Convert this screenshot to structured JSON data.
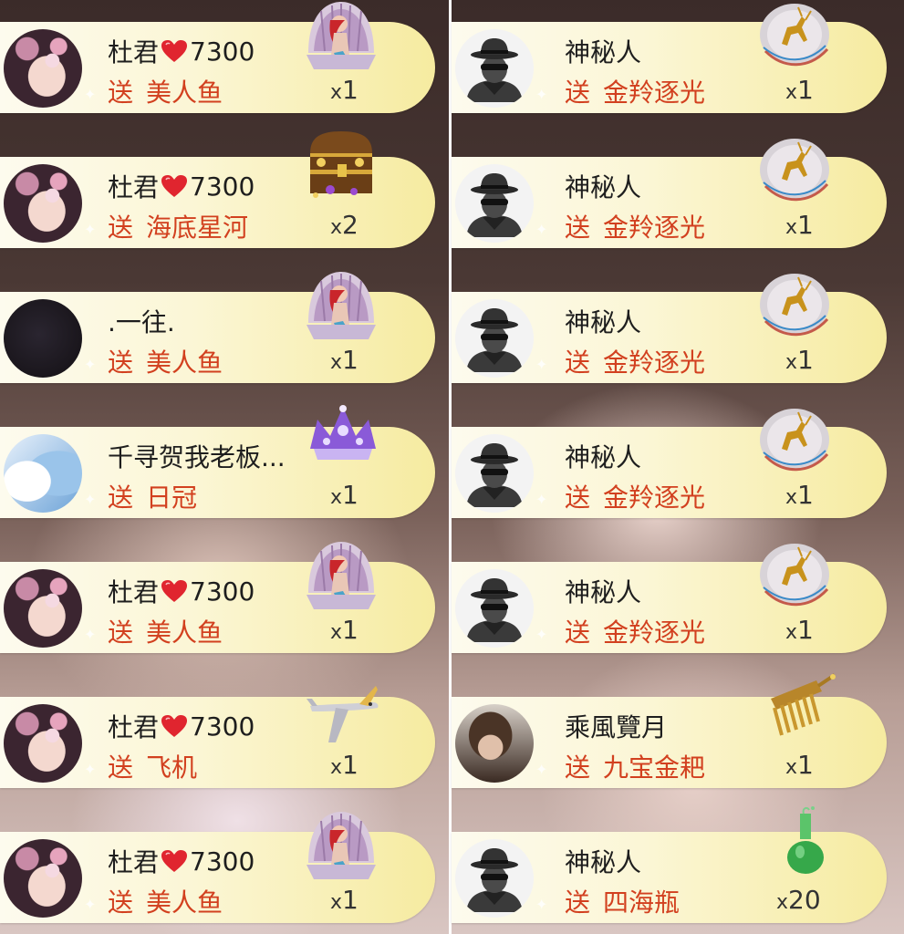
{
  "left_column": [
    {
      "name": "杜君",
      "level": "7300",
      "action": "送",
      "gift": "美人鱼",
      "count": "1",
      "avatar": "girl",
      "gift_icon": "mermaid-shell"
    },
    {
      "name": "杜君",
      "level": "7300",
      "action": "送",
      "gift": "海底星河",
      "count": "2",
      "avatar": "girl",
      "gift_icon": "treasure-chest"
    },
    {
      "name": ".一往.",
      "level": "",
      "action": "送",
      "gift": "美人鱼",
      "count": "1",
      "avatar": "dark",
      "gift_icon": "mermaid-shell"
    },
    {
      "name": "千寻贺我老板...",
      "level": "",
      "action": "送",
      "gift": "日冠",
      "count": "1",
      "avatar": "anime",
      "gift_icon": "purple-crown"
    },
    {
      "name": "杜君",
      "level": "7300",
      "action": "送",
      "gift": "美人鱼",
      "count": "1",
      "avatar": "girl",
      "gift_icon": "mermaid-shell"
    },
    {
      "name": "杜君",
      "level": "7300",
      "action": "送",
      "gift": "飞机",
      "count": "1",
      "avatar": "girl",
      "gift_icon": "airplane"
    },
    {
      "name": "杜君",
      "level": "7300",
      "action": "送",
      "gift": "美人鱼",
      "count": "1",
      "avatar": "girl",
      "gift_icon": "mermaid-shell"
    }
  ],
  "right_column": [
    {
      "name": "神秘人",
      "action": "送",
      "gift": "金羚逐光",
      "count": "1",
      "avatar": "mystery",
      "gift_icon": "golden-antelope-medal"
    },
    {
      "name": "神秘人",
      "action": "送",
      "gift": "金羚逐光",
      "count": "1",
      "avatar": "mystery",
      "gift_icon": "golden-antelope-medal"
    },
    {
      "name": "神秘人",
      "action": "送",
      "gift": "金羚逐光",
      "count": "1",
      "avatar": "mystery",
      "gift_icon": "golden-antelope-medal"
    },
    {
      "name": "神秘人",
      "action": "送",
      "gift": "金羚逐光",
      "count": "1",
      "avatar": "mystery",
      "gift_icon": "golden-antelope-medal"
    },
    {
      "name": "神秘人",
      "action": "送",
      "gift": "金羚逐光",
      "count": "1",
      "avatar": "mystery",
      "gift_icon": "golden-antelope-medal"
    },
    {
      "name": "乘風覽月",
      "action": "送",
      "gift": "九宝金耙",
      "count": "1",
      "avatar": "photo",
      "gift_icon": "golden-rake"
    },
    {
      "name": "神秘人",
      "action": "送",
      "gift": "四海瓶",
      "count": "20",
      "avatar": "mystery",
      "gift_icon": "green-vase"
    }
  ],
  "count_prefix": "x",
  "colors": {
    "gift_name": "#d2401f",
    "card_end": "#f6eba0",
    "heart": "#e0252f"
  }
}
